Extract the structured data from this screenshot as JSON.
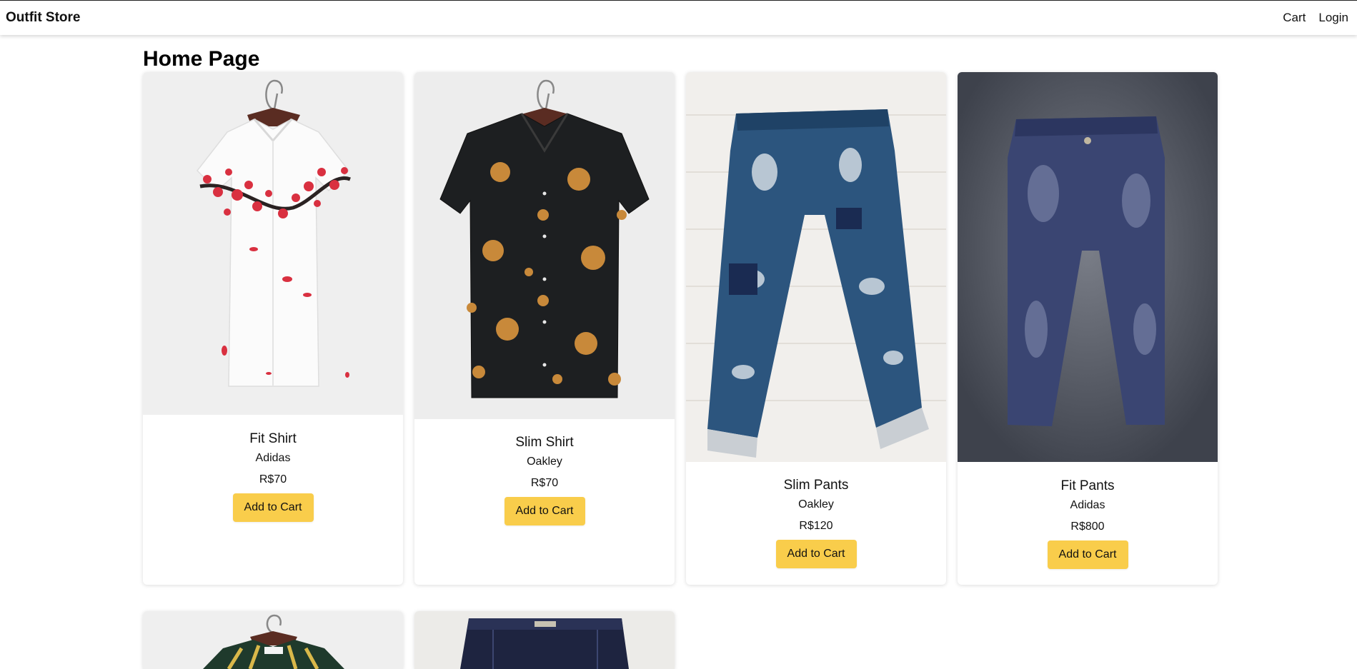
{
  "navbar": {
    "brand": "Outfit Store",
    "links": [
      {
        "label": "Cart"
      },
      {
        "label": "Login"
      }
    ]
  },
  "page": {
    "title": "Home Page"
  },
  "products": [
    {
      "name": "Fit Shirt",
      "brand": "Adidas",
      "price": "R$70",
      "button_label": "Add to Cart",
      "image": "white-floral-shirt"
    },
    {
      "name": "Slim Shirt",
      "brand": "Oakley",
      "price": "R$70",
      "button_label": "Add to Cart",
      "image": "black-sun-moon-shirt"
    },
    {
      "name": "Slim Pants",
      "brand": "Oakley",
      "price": "R$120",
      "button_label": "Add to Cart",
      "image": "distressed-jeans-on-brick"
    },
    {
      "name": "Fit Pants",
      "brand": "Adidas",
      "price": "R$800",
      "button_label": "Add to Cart",
      "image": "blue-jeans-on-gray"
    },
    {
      "image": "striped-shirt"
    },
    {
      "image": "dark-jeans"
    }
  ],
  "colors": {
    "button": "#f9cd4b",
    "text": "#111111"
  }
}
